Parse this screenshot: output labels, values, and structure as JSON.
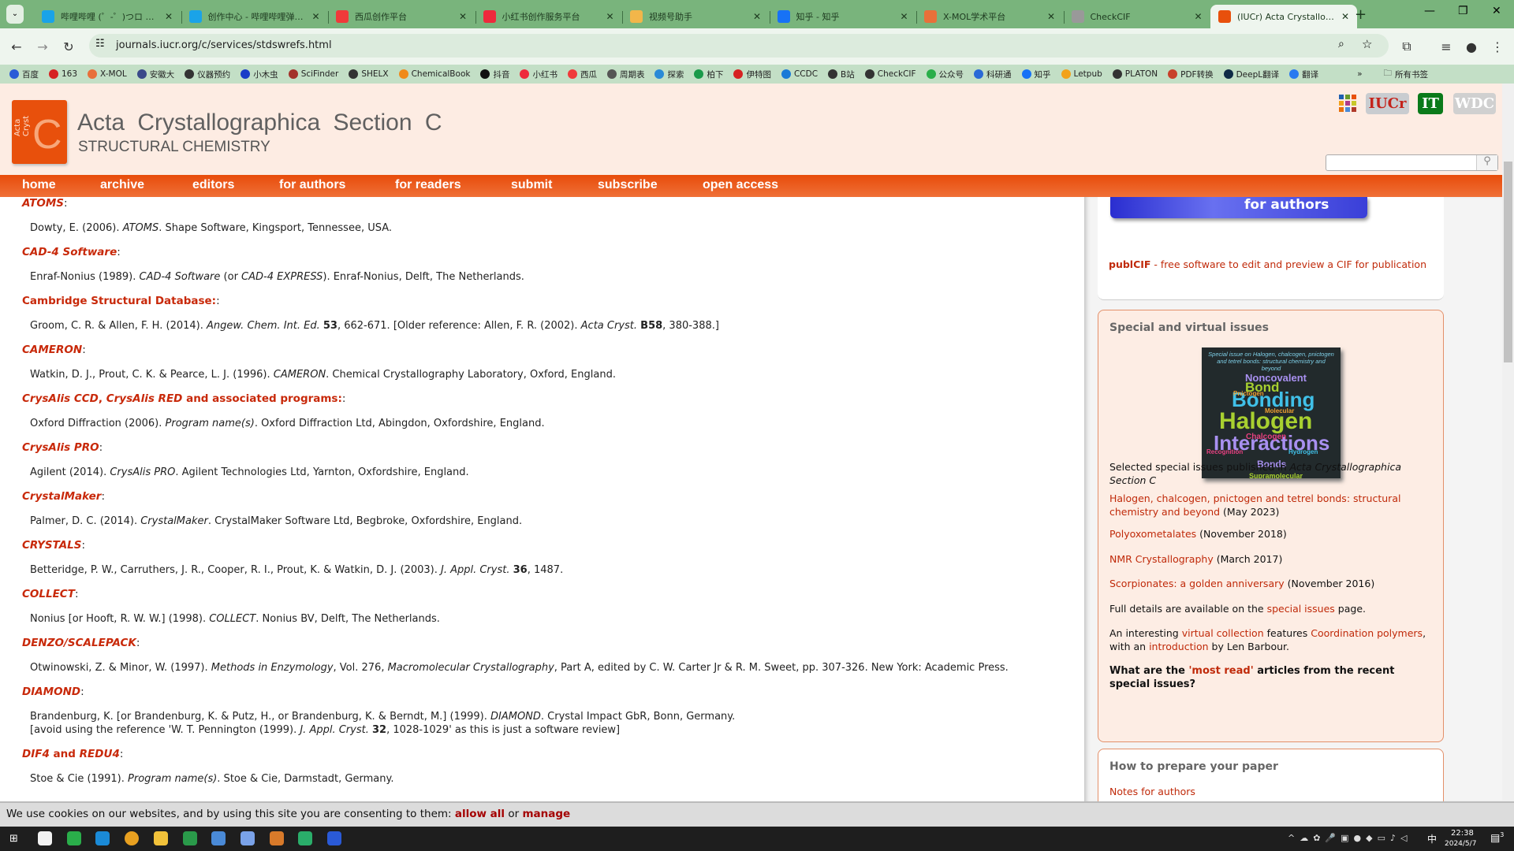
{
  "browser": {
    "tabs": [
      {
        "title": "哔哩哔哩 (゜-゜)つロ 干杯~-bilibili",
        "color": "#1aa3e8"
      },
      {
        "title": "创作中心 - 哔哩哔哩弹幕视频网",
        "color": "#1aa3e8"
      },
      {
        "title": "西瓜创作平台",
        "color": "#f03a3a"
      },
      {
        "title": "小红书创作服务平台",
        "color": "#ee2a3c"
      },
      {
        "title": "视频号助手",
        "color": "#f2b64a"
      },
      {
        "title": "知乎 - 知乎",
        "color": "#1772f6"
      },
      {
        "title": "X-MOL学术平台",
        "color": "#e8703a"
      },
      {
        "title": "CheckCIF",
        "color": "#999999"
      },
      {
        "title": "(IUCr) Acta Crystallographica",
        "color": "#e8500c",
        "active": true
      }
    ],
    "url": "journals.iucr.org/c/services/stdswrefs.html",
    "bookmarks": [
      {
        "label": "百度",
        "color": "#2a5bd7"
      },
      {
        "label": "163",
        "color": "#d62222"
      },
      {
        "label": "X-MOL",
        "color": "#e8703a"
      },
      {
        "label": "安徽大",
        "color": "#3a4a8a"
      },
      {
        "label": "仪器预约",
        "color": "#333333"
      },
      {
        "label": "小木虫",
        "color": "#1a3cc8"
      },
      {
        "label": "SciFinder",
        "color": "#a3312a"
      },
      {
        "label": "SHELX",
        "color": "#333333"
      },
      {
        "label": "ChemicalBook",
        "color": "#f08a1a"
      },
      {
        "label": "抖音",
        "color": "#111111"
      },
      {
        "label": "小红书",
        "color": "#ee2a3c"
      },
      {
        "label": "西瓜",
        "color": "#f03a3a"
      },
      {
        "label": "周期表",
        "color": "#555555"
      },
      {
        "label": "探索",
        "color": "#2a8ad7"
      },
      {
        "label": "柏下",
        "color": "#1a9a4a"
      },
      {
        "label": "伊特图",
        "color": "#d62222"
      },
      {
        "label": "CCDC",
        "color": "#1a7ad7"
      },
      {
        "label": "B站",
        "color": "#333333"
      },
      {
        "label": "CheckCIF",
        "color": "#333333"
      },
      {
        "label": "公众号",
        "color": "#2aae4a"
      },
      {
        "label": "科研通",
        "color": "#2a6ad7"
      },
      {
        "label": "知乎",
        "color": "#1772f6"
      },
      {
        "label": "Letpub",
        "color": "#f2a21a"
      },
      {
        "label": "PLATON",
        "color": "#333333"
      },
      {
        "label": "PDF转换",
        "color": "#c8402a"
      },
      {
        "label": "DeepL翻译",
        "color": "#0f2b46"
      },
      {
        "label": "翻译",
        "color": "#2a7af0"
      }
    ],
    "more": "»",
    "all_bookmarks": "所有书签"
  },
  "header": {
    "logo_vertical": "Acta Cryst",
    "logo_letter": "C",
    "title": "Acta Crystallographica Section C",
    "subtitle": "STRUCTURAL CHEMISTRY",
    "badges": {
      "iucr": "IUCr",
      "it": "IT",
      "wdc": "WDC"
    },
    "search_placeholder": ""
  },
  "nav": [
    "home",
    "archive",
    "editors",
    "for authors",
    "for readers",
    "submit",
    "subscribe",
    "open access"
  ],
  "main": {
    "entries": [
      {
        "h": [
          [
            "ATOMS",
            "i"
          ]
        ],
        "r": [
          [
            "Dowty, E. (2006). ",
            ""
          ],
          [
            "ATOMS",
            "i"
          ],
          [
            ". Shape Software, Kingsport, Tennessee, USA.",
            ""
          ]
        ]
      },
      {
        "h": [
          [
            "CAD-4 Software",
            "i"
          ]
        ],
        "r": [
          [
            "Enraf-Nonius (1989). ",
            ""
          ],
          [
            "CAD-4 Software",
            "i"
          ],
          [
            " (or ",
            ""
          ],
          [
            "CAD-4 EXPRESS",
            "i"
          ],
          [
            "). Enraf-Nonius, Delft, The Netherlands.",
            ""
          ]
        ]
      },
      {
        "h": [
          [
            "Cambridge Structural Database:",
            ""
          ]
        ],
        "r": [
          [
            "Groom, C. R. & Allen, F. H. (2014). ",
            ""
          ],
          [
            "Angew. Chem. Int. Ed.",
            "i"
          ],
          [
            " ",
            ""
          ],
          [
            "53",
            "b"
          ],
          [
            ", 662-671. [Older reference: Allen, F. R. (2002). ",
            ""
          ],
          [
            "Acta Cryst.",
            "i"
          ],
          [
            " ",
            ""
          ],
          [
            "B58",
            "b"
          ],
          [
            ", 380-388.]",
            ""
          ]
        ]
      },
      {
        "h": [
          [
            "CAMERON",
            "i"
          ]
        ],
        "r": [
          [
            "Watkin, D. J., Prout, C. K. & Pearce, L. J. (1996). ",
            ""
          ],
          [
            "CAMERON",
            "i"
          ],
          [
            ". Chemical Crystallography Laboratory, Oxford, England.",
            ""
          ]
        ]
      },
      {
        "h": [
          [
            "CrysAlis CCD",
            "i"
          ],
          [
            ", ",
            ""
          ],
          [
            "CrysAlis RED",
            "i"
          ],
          [
            " and associated programs:",
            ""
          ]
        ],
        "r": [
          [
            "Oxford Diffraction (2006). ",
            ""
          ],
          [
            "Program name(s)",
            "i"
          ],
          [
            ". Oxford Diffraction Ltd, Abingdon, Oxfordshire, England.",
            ""
          ]
        ]
      },
      {
        "h": [
          [
            "CrysAlis PRO",
            "i"
          ]
        ],
        "r": [
          [
            "Agilent (2014). ",
            ""
          ],
          [
            "CrysAlis PRO",
            "i"
          ],
          [
            ". Agilent Technologies Ltd, Yarnton, Oxfordshire, England.",
            ""
          ]
        ]
      },
      {
        "h": [
          [
            "CrystalMaker",
            "i"
          ]
        ],
        "r": [
          [
            "Palmer, D. C. (2014). ",
            ""
          ],
          [
            "CrystalMaker",
            "i"
          ],
          [
            ". CrystalMaker Software Ltd, Begbroke, Oxfordshire, England.",
            ""
          ]
        ]
      },
      {
        "h": [
          [
            "CRYSTALS",
            "i"
          ]
        ],
        "r": [
          [
            "Betteridge, P. W., Carruthers, J. R., Cooper, R. I., Prout, K. & Watkin, D. J. (2003). ",
            ""
          ],
          [
            "J. Appl. Cryst.",
            "i"
          ],
          [
            " ",
            ""
          ],
          [
            "36",
            "b"
          ],
          [
            ", 1487.",
            ""
          ]
        ]
      },
      {
        "h": [
          [
            "COLLECT",
            "i"
          ]
        ],
        "r": [
          [
            "Nonius [or Hooft, R. W. W.] (1998). ",
            ""
          ],
          [
            "COLLECT",
            "i"
          ],
          [
            ". Nonius BV, Delft, The Netherlands.",
            ""
          ]
        ]
      },
      {
        "h": [
          [
            "DENZO/SCALEPACK",
            "i"
          ]
        ],
        "r": [
          [
            "Otwinowski, Z. & Minor, W. (1997). ",
            ""
          ],
          [
            "Methods in Enzymology",
            "i"
          ],
          [
            ", Vol. 276, ",
            ""
          ],
          [
            "Macromolecular Crystallography",
            "i"
          ],
          [
            ", Part A, edited by C. W. Carter Jr & R. M. Sweet, pp. 307-326. New York: Academic Press.",
            ""
          ]
        ]
      },
      {
        "h": [
          [
            "DIAMOND",
            "i"
          ]
        ],
        "r": [
          [
            "Brandenburg, K. [or Brandenburg, K. & Putz, H., or Brandenburg, K. & Berndt, M.] (1999). ",
            ""
          ],
          [
            "DIAMOND",
            "i"
          ],
          [
            ". Crystal Impact GbR, Bonn, Germany.",
            ""
          ],
          [
            "\n",
            ""
          ],
          [
            "[avoid using the reference 'W. T. Pennington (1999). ",
            ""
          ],
          [
            "J. Appl. Cryst.",
            "i"
          ],
          [
            " ",
            ""
          ],
          [
            "32",
            "b"
          ],
          [
            ", 1028-1029' as this is just a software review]",
            ""
          ]
        ]
      },
      {
        "h": [
          [
            "DIF4",
            "i"
          ],
          [
            " and ",
            ""
          ],
          [
            "REDU4",
            "i"
          ]
        ],
        "r": [
          [
            "Stoe & Cie (1991). ",
            ""
          ],
          [
            "Program name(s)",
            "i"
          ],
          [
            ". Stoe & Cie, Darmstadt, Germany.",
            ""
          ]
        ]
      }
    ]
  },
  "sidebar": {
    "banner_label": "for authors",
    "publcif": [
      [
        "publCIF",
        "b"
      ],
      [
        " - free software to edit and preview a CIF for publication",
        ""
      ]
    ],
    "special_title": "Special and virtual issues",
    "cover_words": [
      "Special issue on Halogen, chalcogen, pnictogen and tetrel bonds: structural chemistry and beyond",
      "Noncovalent",
      "Bond",
      "Bonding",
      "Halogen",
      "Interactions",
      "Chalcogen",
      "Recognition",
      "Hydrogen",
      "Bonds",
      "Supramolecular",
      "Pnictogen",
      "Molecular"
    ],
    "paras": [
      [
        [
          "Selected special issues published in ",
          ""
        ],
        [
          "Acta Crystallographica Section C",
          "i"
        ]
      ],
      [
        [
          "Halogen, chalcogen, pnictogen and tetrel bonds: structural chemistry and beyond",
          "a"
        ],
        [
          " (May 2023)",
          ""
        ]
      ],
      [
        [
          "Polyoxometalates",
          "a"
        ],
        [
          " (November 2018)",
          ""
        ]
      ],
      [
        [
          "NMR Crystallography",
          "a"
        ],
        [
          " (March 2017)",
          ""
        ]
      ],
      [
        [
          "Scorpionates: a golden anniversary",
          "a"
        ],
        [
          " (November 2016)",
          ""
        ]
      ],
      [
        [
          "Full details are available on the ",
          ""
        ],
        [
          "special issues",
          "a"
        ],
        [
          " page.",
          ""
        ]
      ],
      [
        [
          "An interesting ",
          ""
        ],
        [
          "virtual collection",
          "a"
        ],
        [
          " features ",
          ""
        ],
        [
          "Coordination polymers",
          "a"
        ],
        [
          ", with an ",
          ""
        ],
        [
          "introduction",
          "a"
        ],
        [
          " by Len Barbour.",
          ""
        ]
      ],
      [
        [
          "What are the ",
          "b"
        ],
        [
          "'most read'",
          "ab"
        ],
        [
          " articles from the recent special issues?",
          "b"
        ]
      ]
    ],
    "prepare_title": "How to prepare your paper",
    "notes_link": "Notes for authors"
  },
  "cookie": {
    "text": "We use cookies on our websites, and by using this site you are consenting to them: ",
    "allow": "allow all",
    "or": " or ",
    "manage": "manage"
  },
  "taskbar": {
    "time": "22:38",
    "date": "2024/5/7",
    "ime": "中",
    "notifications": "3"
  },
  "colors": {
    "accent": "#e8500c",
    "link": "#c8290a",
    "tabstrip": "#79b47c"
  }
}
